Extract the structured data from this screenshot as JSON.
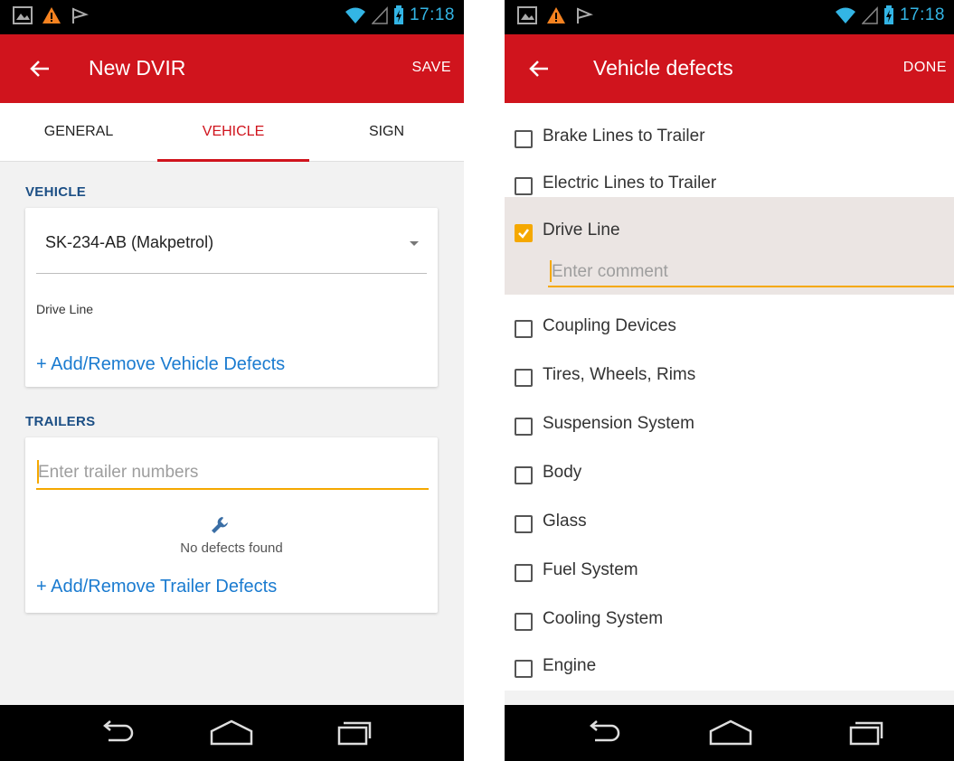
{
  "status_bar": {
    "time": "17:18"
  },
  "screen1": {
    "title": "New DVIR",
    "action": "SAVE",
    "tabs": [
      {
        "label": "GENERAL",
        "active": false
      },
      {
        "label": "VEHICLE",
        "active": true
      },
      {
        "label": "SIGN",
        "active": false
      }
    ],
    "vehicle_section": {
      "label": "VEHICLE",
      "selected_vehicle": "SK-234-AB (Makpetrol)",
      "defects_text": "Drive Line",
      "add_link": "+ Add/Remove Vehicle Defects"
    },
    "trailers_section": {
      "label": "TRAILERS",
      "placeholder": "Enter trailer numbers",
      "empty_text": "No defects found",
      "add_link": "+ Add/Remove Trailer Defects"
    }
  },
  "screen2": {
    "title": "Vehicle defects",
    "action": "DONE",
    "comment_placeholder": "Enter comment",
    "items": [
      {
        "label": "Brake Lines to Trailer",
        "checked": false
      },
      {
        "label": "Electric Lines to Trailer",
        "checked": false
      },
      {
        "label": "Drive Line",
        "checked": true
      },
      {
        "label": "Coupling Devices",
        "checked": false
      },
      {
        "label": "Tires, Wheels, Rims",
        "checked": false
      },
      {
        "label": "Suspension System",
        "checked": false
      },
      {
        "label": "Body",
        "checked": false
      },
      {
        "label": "Glass",
        "checked": false
      },
      {
        "label": "Fuel System",
        "checked": false
      },
      {
        "label": "Cooling System",
        "checked": false
      },
      {
        "label": "Engine",
        "checked": false
      }
    ]
  },
  "colors": {
    "app_bar": "#d0141d",
    "accent": "#f5a800",
    "link": "#1a7bd0",
    "section_label": "#1c4f85",
    "status_icons": "#33b5e5"
  },
  "icons": {
    "status_left": [
      "gallery-icon",
      "warning-icon",
      "notification-flag-icon"
    ],
    "status_right": [
      "wifi-icon",
      "signal-icon",
      "battery-charging-icon"
    ],
    "nav": [
      "back-nav-icon",
      "home-nav-icon",
      "recents-nav-icon"
    ]
  }
}
